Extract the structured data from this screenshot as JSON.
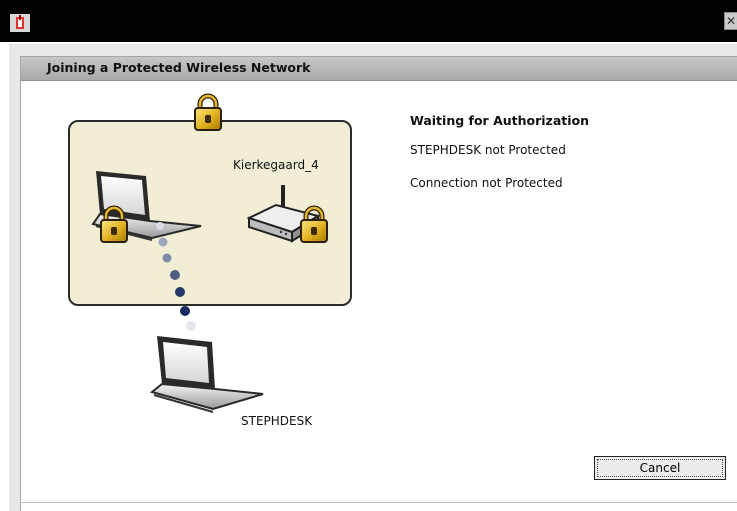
{
  "window": {
    "app_icon": "wireless-antenna-icon",
    "close_icon": "close-icon",
    "close_label": "✕"
  },
  "header": {
    "title": "Joining a Protected Wireless Network"
  },
  "diagram": {
    "network_name": "Kierkegaard_4",
    "client_name": "STEPHDESK",
    "icons": [
      "padlock-icon",
      "laptop-icon",
      "router-icon"
    ]
  },
  "status": {
    "title": "Waiting for Authorization",
    "line1": "STEPHDESK not Protected",
    "line2": "Connection not Protected"
  },
  "buttons": {
    "cancel": "Cancel"
  },
  "colors": {
    "network_box": "#f1eed5",
    "lock_gold": "#e0b020",
    "dot_blue": "#1a3a7a"
  }
}
